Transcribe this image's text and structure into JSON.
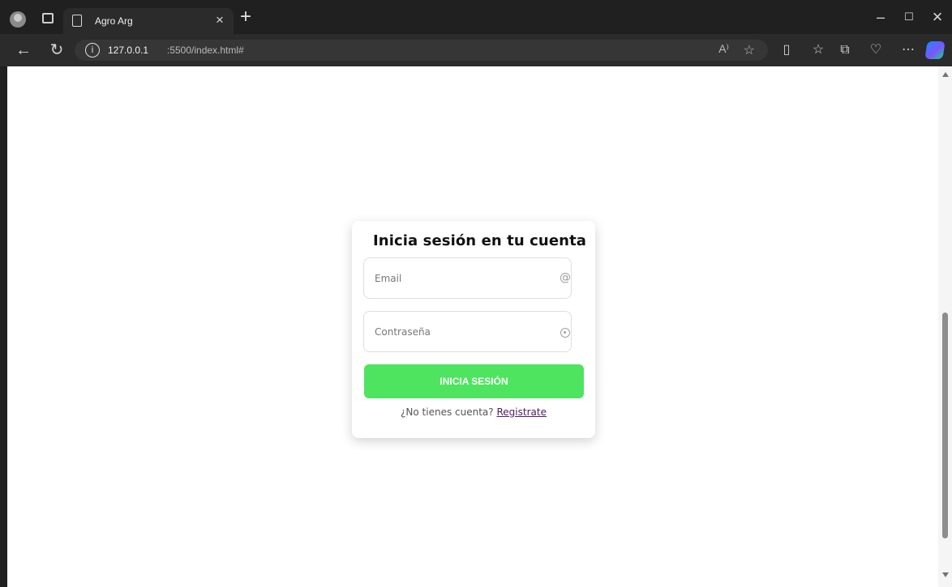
{
  "browser": {
    "tab_title": "Agro Arg",
    "new_tab_icon": "plus-icon",
    "url_host": "127.0.0.1",
    "url_path": ":5500/index.html#",
    "read_aloud_label": "A⁾",
    "window_minimize": "–",
    "window_restore": "☐",
    "window_close": "×"
  },
  "login": {
    "title": "Inicia sesión en tu cuenta",
    "email_placeholder": "Email",
    "password_placeholder": "Contraseña",
    "submit_label": "INICIA SESIÓN",
    "no_account_text": "¿No tienes cuenta?",
    "register_link": "Registrate"
  }
}
